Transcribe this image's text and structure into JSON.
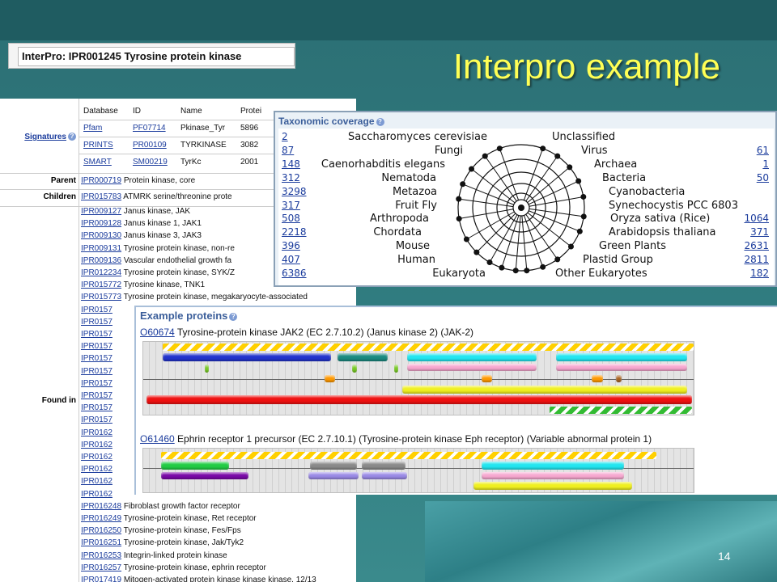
{
  "slide": {
    "title": "Interpro example",
    "page_number": "14",
    "colors": {
      "title": "#ffff55",
      "background": "#2f7a7e"
    }
  },
  "interpro_header": "InterPro: IPR001245 Tyrosine protein kinase",
  "signatures": {
    "label": "Signatures",
    "columns": [
      "Database",
      "ID",
      "Name",
      "Protei"
    ],
    "rows": [
      {
        "database": "Pfam",
        "id": "PF07714",
        "name": "Pkinase_Tyr",
        "proteins": "5896"
      },
      {
        "database": "PRINTS",
        "id": "PR00109",
        "name": "TYRKINASE",
        "proteins": "3082"
      },
      {
        "database": "SMART",
        "id": "SM00219",
        "name": "TyrKc",
        "proteins": "2001"
      }
    ]
  },
  "parent": {
    "label": "Parent",
    "acc": "IPR000719",
    "text": "Protein kinase, core"
  },
  "children": {
    "label": "Children",
    "acc": "IPR015783",
    "text": "ATMRK serine/threonine prote"
  },
  "found_in": {
    "label": "Found in",
    "rows": [
      {
        "acc": "IPR009127",
        "text": "Janus kinase, JAK"
      },
      {
        "acc": "IPR009128",
        "text": "Janus kinase 1, JAK1"
      },
      {
        "acc": "IPR009130",
        "text": "Janus kinase 3, JAK3"
      },
      {
        "acc": "IPR009131",
        "text": "Tyrosine protein kinase, non-re"
      },
      {
        "acc": "IPR009136",
        "text": "Vascular endothelial growth fa"
      },
      {
        "acc": "IPR012234",
        "text": "Tyrosine protein kinase, SYK/Z"
      },
      {
        "acc": "IPR015772",
        "text": "Tyrosine kinase, TNK1"
      },
      {
        "acc": "IPR015773",
        "text": "Tyrosine protein kinase, megakaryocyte-associated"
      },
      {
        "acc": "IPR0157",
        "text": ""
      },
      {
        "acc": "IPR0157",
        "text": ""
      },
      {
        "acc": "IPR0157",
        "text": ""
      },
      {
        "acc": "IPR0157",
        "text": ""
      },
      {
        "acc": "IPR0157",
        "text": ""
      },
      {
        "acc": "IPR0157",
        "text": ""
      },
      {
        "acc": "IPR0157",
        "text": ""
      },
      {
        "acc": "IPR0157",
        "text": ""
      },
      {
        "acc": "IPR0157",
        "text": ""
      },
      {
        "acc": "IPR0157",
        "text": ""
      },
      {
        "acc": "IPR0162",
        "text": ""
      },
      {
        "acc": "IPR0162",
        "text": ""
      },
      {
        "acc": "IPR0162",
        "text": ""
      },
      {
        "acc": "IPR0162",
        "text": ""
      },
      {
        "acc": "IPR0162",
        "text": ""
      },
      {
        "acc": "IPR0162",
        "text": ""
      },
      {
        "acc": "IPR016248",
        "text": "Fibroblast growth factor receptor"
      },
      {
        "acc": "IPR016249",
        "text": "Tyrosine-protein kinase, Ret receptor"
      },
      {
        "acc": "IPR016250",
        "text": "Tyrosine-protein kinase, Fes/Fps"
      },
      {
        "acc": "IPR016251",
        "text": "Tyrosine-protein kinase, Jak/Tyk2"
      },
      {
        "acc": "IPR016253",
        "text": "Integrin-linked protein kinase"
      },
      {
        "acc": "IPR016257",
        "text": "Tyrosine-protein kinase, ephrin receptor"
      },
      {
        "acc": "IPR017419",
        "text": "Mitogen-activated protein kinase kinase kinase, 12/13"
      }
    ]
  },
  "taxonomic_coverage": {
    "title": "Taxonomic coverage",
    "left": [
      {
        "count": "2",
        "taxon": "Saccharomyces cerevisiae"
      },
      {
        "count": "87",
        "taxon": "Fungi"
      },
      {
        "count": "148",
        "taxon": "Caenorhabditis elegans"
      },
      {
        "count": "312",
        "taxon": "Nematoda"
      },
      {
        "count": "3298",
        "taxon": "Metazoa"
      },
      {
        "count": "317",
        "taxon": "Fruit Fly"
      },
      {
        "count": "508",
        "taxon": "Arthropoda"
      },
      {
        "count": "2218",
        "taxon": "Chordata"
      },
      {
        "count": "396",
        "taxon": "Mouse"
      },
      {
        "count": "407",
        "taxon": "Human"
      },
      {
        "count": "6386",
        "taxon": "Eukaryota"
      }
    ],
    "right": [
      {
        "taxon": "Unclassified",
        "count": ""
      },
      {
        "taxon": "Virus",
        "count": "61"
      },
      {
        "taxon": "Archaea",
        "count": "1"
      },
      {
        "taxon": "Bacteria",
        "count": "50"
      },
      {
        "taxon": "Cyanobacteria",
        "count": ""
      },
      {
        "taxon": "Synechocystis PCC 6803",
        "count": ""
      },
      {
        "taxon": "Oryza sativa (Rice)",
        "count": "1064"
      },
      {
        "taxon": "Arabidopsis thaliana",
        "count": "371"
      },
      {
        "taxon": "Green Plants",
        "count": "2631"
      },
      {
        "taxon": "Plastid Group",
        "count": "2811"
      },
      {
        "taxon": "Other Eukaryotes",
        "count": "182"
      }
    ]
  },
  "example_proteins": {
    "title": "Example proteins",
    "proteins": [
      {
        "acc": "O60674",
        "description": "Tyrosine-protein kinase JAK2 (EC 2.7.10.2) (Janus kinase 2) (JAK-2)"
      },
      {
        "acc": "O61460",
        "description": "Ephrin receptor 1 precursor (EC 2.7.10.1) (Tyrosine-protein kinase Eph receptor) (Variable abnormal protein 1)"
      }
    ],
    "domain_colors": {
      "blue": "#2233cc",
      "teal": "#1a8a80",
      "cyan": "#22e6f0",
      "pink": "#f7a8d0",
      "yellow": "#f0f020",
      "red": "#ee1111",
      "orange": "#ff9900",
      "green": "#22cc44",
      "purple": "#7a0aa8",
      "gray": "#8a8a8a",
      "lavender": "#9a8ae6",
      "brown": "#aa6622",
      "smallgreen": "#77cc22"
    }
  }
}
